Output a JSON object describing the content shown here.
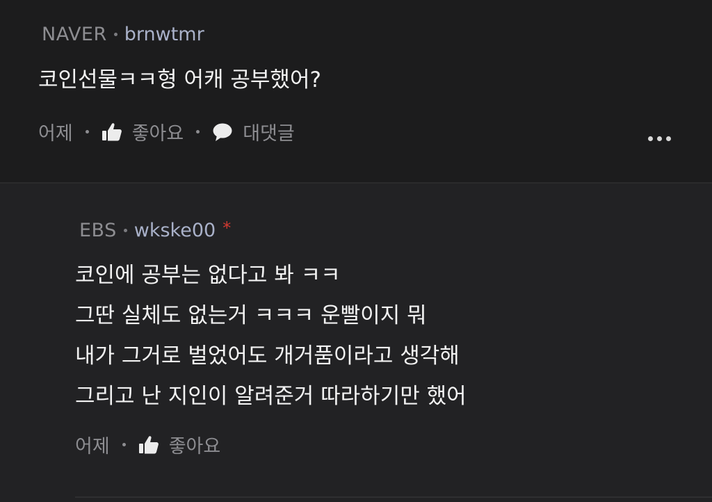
{
  "comments": [
    {
      "source": "NAVER",
      "username": "brnwtmr",
      "text": "코인선물ㅋㅋ형 어캐 공부했어?",
      "time": "어제",
      "like_label": "좋아요",
      "reply_label": "대댓글"
    }
  ],
  "replies": [
    {
      "source": "EBS",
      "username": "wkske00",
      "badge": "*",
      "lines": [
        "코인에 공부는 없다고 봐 ㅋㅋ",
        "그딴 실체도 없는거 ㅋㅋㅋ 운빨이지 뭐",
        "내가 그거로 벌었어도 개거품이라고 생각해",
        "그리고 난 지인이 알려준거 따라하기만 했어"
      ],
      "time": "어제",
      "like_label": "좋아요"
    }
  ],
  "icons": {
    "like": "thumbs-up-icon",
    "reply": "speech-bubble-icon",
    "more": "more-dots-icon"
  },
  "colors": {
    "background": "#1c1c1d",
    "reply_background": "#222224",
    "text": "#f2f2f2",
    "muted": "#8d8d91",
    "username": "#a9b1c9",
    "badge": "#d23a32"
  }
}
